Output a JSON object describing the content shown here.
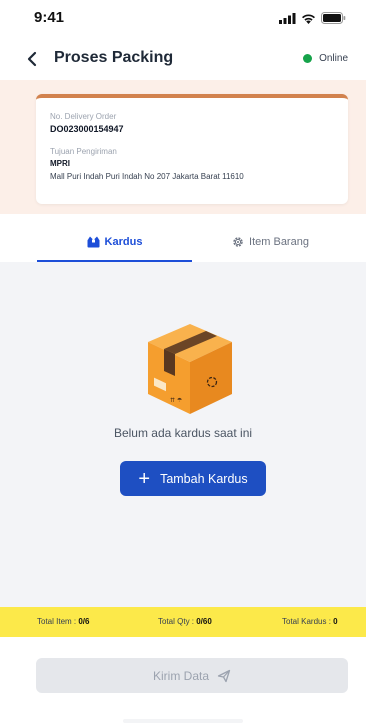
{
  "status_bar": {
    "time": "9:41"
  },
  "header": {
    "title": "Proses Packing",
    "status": "Online",
    "status_color": "#16a34a"
  },
  "order": {
    "delivery_order_label": "No. Delivery Order",
    "delivery_order_value": "DO023000154947",
    "destination_label": "Tujuan Pengiriman",
    "destination_code": "MPRI",
    "destination_address": "Mall Puri Indah Puri Indah No 207 Jakarta Barat 11610"
  },
  "tabs": [
    {
      "label": "Kardus",
      "active": true,
      "icon": "box-icon"
    },
    {
      "label": "Item Barang",
      "active": false,
      "icon": "gear-icon"
    }
  ],
  "empty_state": {
    "message": "Belum ada kardus saat ini",
    "illustration": "cardboard-box"
  },
  "add_button": {
    "label": "Tambah Kardus"
  },
  "totals": {
    "item_label": "Total Item : ",
    "item_value": "0/6",
    "qty_label": "Total Qty : ",
    "qty_value": "0/60",
    "kardus_label": "Total Kardus : ",
    "kardus_value": "0"
  },
  "send_button": {
    "label": "Kirim Data"
  },
  "colors": {
    "accent": "#1e4fc2",
    "totals_bg": "#fce94a",
    "card_top": "#d2824e"
  }
}
